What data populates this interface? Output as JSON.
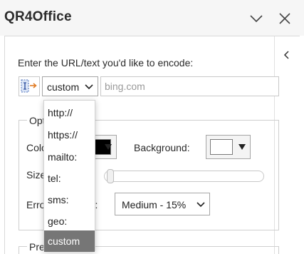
{
  "pane": {
    "title": "QR4Office"
  },
  "addin": {
    "prompt": "Enter the URL/text you'd like to encode:",
    "scheme_select": {
      "value": "custom",
      "options": [
        "http://",
        "https://",
        "mailto:",
        "tel:",
        "sms:",
        "geo:",
        "custom"
      ],
      "selected_index": 6
    },
    "text_input": {
      "value": "",
      "placeholder": "bing.com"
    },
    "options": {
      "legend": "Options",
      "color_label": "Color:",
      "color_value": "#000000",
      "background_label": "Background:",
      "background_value": "#ffffff",
      "size_label": "Size:",
      "size_value": 0.02,
      "error_label": "Error correction:",
      "error_value": "Medium - 15%"
    },
    "preview": {
      "legend": "Preview"
    }
  },
  "icons": {
    "minimize": "chevron-down-icon",
    "close": "close-icon",
    "collapse": "chevron-left-icon",
    "source": "insert-source-icon",
    "select_chevron": "chevron-down-icon",
    "color_arrow": "triangle-down-icon"
  },
  "colors": {
    "header_bg": "#f6f6f6",
    "selected_item_bg": "#767676",
    "border": "#cfcfcf"
  }
}
